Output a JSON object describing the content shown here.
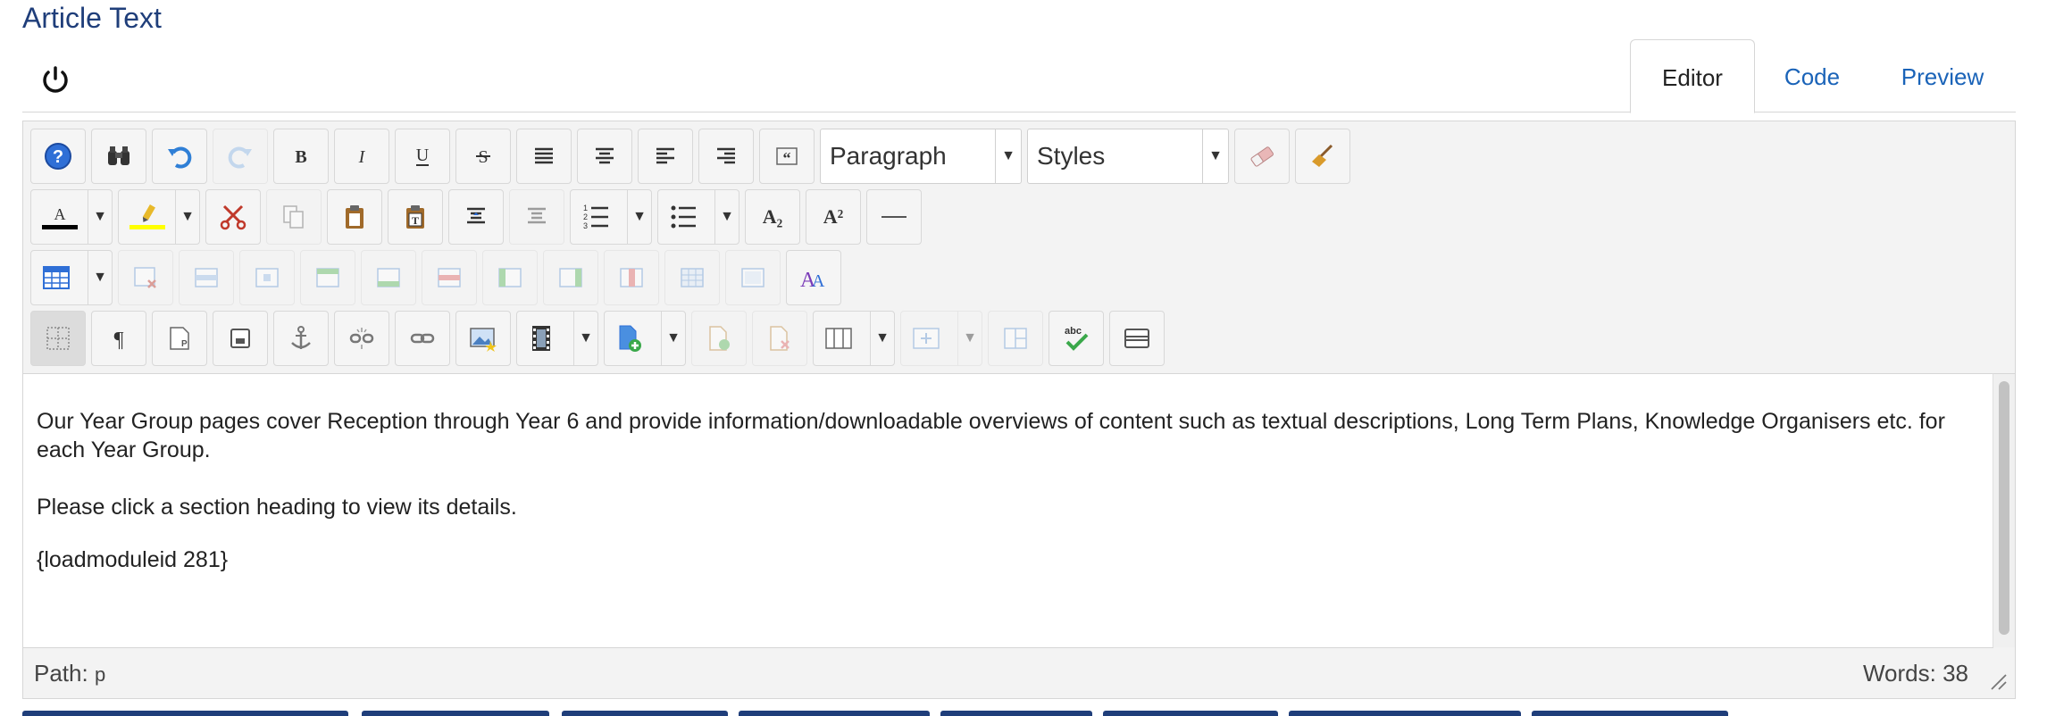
{
  "page": {
    "title": "Article Text"
  },
  "tabs": [
    {
      "label": "Editor",
      "active": true
    },
    {
      "label": "Code",
      "active": false
    },
    {
      "label": "Preview",
      "active": false
    }
  ],
  "toolbar": {
    "format_select": "Paragraph",
    "styles_select": "Styles",
    "subscript_label": "A₂",
    "superscript_label": "A²"
  },
  "content": {
    "paragraphs": [
      "Our Year Group pages cover Reception through Year 6 and provide information/downloadable overviews of content such as textual descriptions, Long Term Plans, Knowledge Organisers etc. for each Year Group.",
      "Please click a section heading to view its details.",
      "{loadmoduleid 281}"
    ]
  },
  "status": {
    "path_label": "Path:",
    "path_value": "p",
    "words_label": "Words: 38"
  },
  "colors": {
    "title": "#1f3e7a",
    "link": "#1a63b8",
    "font_color_swatch": "#000000",
    "highlight_swatch": "#ffff00"
  }
}
